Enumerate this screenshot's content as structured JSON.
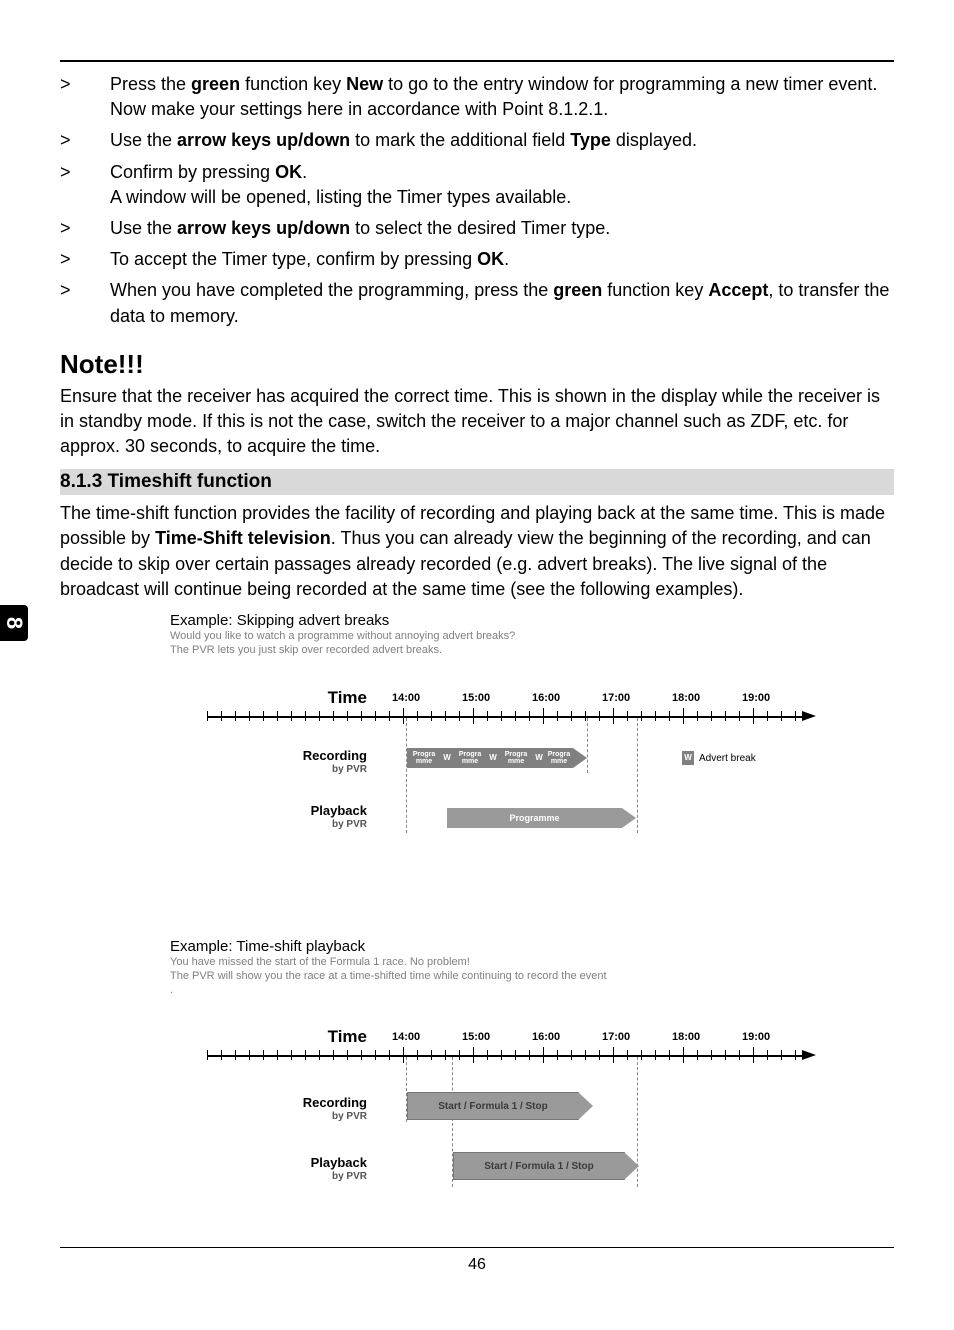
{
  "sideTab": "8",
  "steps": [
    {
      "mark": ">",
      "html": "Press the <b>green</b> function key <b>New</b> to go to the entry window for programming a new timer event.<br>Now make your settings here in accordance with Point 8.1.2.1."
    },
    {
      "mark": ">",
      "html": "Use the <b>arrow keys up/down</b> to mark the additional field <b>Type</b> displayed."
    },
    {
      "mark": ">",
      "html": "Confirm by pressing <b>OK</b>.<br>A window will be opened, listing the Timer types available."
    },
    {
      "mark": ">",
      "html": "Use the <b>arrow keys up/down</b> to select the desired Timer type."
    },
    {
      "mark": ">",
      "html": "To accept the Timer type, confirm by pressing <b>OK</b>."
    },
    {
      "mark": ">",
      "html": "When you have completed the programming, press the <b>green</b> function key <b>Accept</b>, to transfer the data to memory."
    }
  ],
  "noteHeading": "Note!!!",
  "notePara": "Ensure that the receiver has acquired the correct time. This is shown in the display while the receiver is in standby mode. If this is not the case, switch the receiver to a major channel such as ZDF, etc. for approx. 30 seconds, to acquire the time.",
  "sectionTitle": "8.1.3 Timeshift function",
  "sectionPara": "The time-shift function provides the facility of recording and playing back at the same time. This is made possible by <b>Time-Shift television</b>. Thus you can already view the beginning of the recording, and can decide to skip over certain passages already recorded (e.g. advert breaks). The live signal of the broadcast will continue being recorded at the same time (see the following examples).",
  "ex1": {
    "title": "Example: Skipping advert breaks",
    "sub1": "Would you like to watch a programme without annoying advert breaks?",
    "sub2": "The PVR lets you just skip over recorded advert breaks."
  },
  "diag": {
    "labels": {
      "time": "Time",
      "recording": "Recording",
      "byPvr": "by PVR",
      "playback": "Playback"
    },
    "times": [
      "14:00",
      "15:00",
      "16:00",
      "17:00",
      "18:00",
      "19:00"
    ],
    "seg": {
      "programme": "Progra\nmme",
      "w": "W",
      "programmeFull": "Programme"
    },
    "legend": {
      "w": "W",
      "text": "Advert break"
    }
  },
  "ex2": {
    "title": "Example: Time-shift playback",
    "sub1": "You have missed the start of the Formula 1 race. No problem!",
    "sub2": "The PVR will show you the race at a time-shifted time while continuing to record the event",
    "dot": "."
  },
  "diag2": {
    "seg1": "Start   /   Formula 1   /   Stop",
    "seg2": "Start   /   Formula 1   /   Stop"
  },
  "pageNum": "46"
}
